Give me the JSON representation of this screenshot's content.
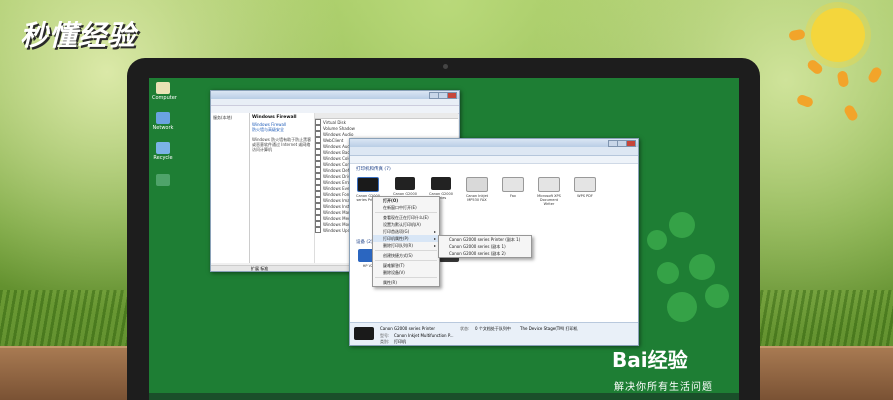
{
  "watermark": {
    "logo_text": "秒懂经验"
  },
  "branding": {
    "baidu_text": "Bai经验",
    "baidu_slogan": "解决你所有生活问题"
  },
  "desktop": {
    "icons": [
      {
        "label": "Computer"
      },
      {
        "label": "Network"
      },
      {
        "label": "Recycle"
      },
      {
        "label": ""
      }
    ]
  },
  "firewall_window": {
    "title": "Windows Firewall",
    "side_link_1": "Windows Firewall",
    "side_link_2": "防火墙与高级安全",
    "side_text": "Windows 防火墙有助于防止黑客或恶意软件通过 Internet 或网络访问计算机",
    "services": [
      "Virtual Disk",
      "Volume Shadow",
      "Windows Audio",
      "WebClient",
      "Windows Audi...",
      "Windows Back...",
      "Windows Color...",
      "Windows Conn...",
      "Windows Defe...",
      "Windows Driv...",
      "Windows Error...",
      "Windows Event...",
      "Windows Font...",
      "Windows Imag...",
      "Windows Inst...",
      "Windows Man...",
      "Windows Med...",
      "Windows Mod...",
      "Windows Upd..."
    ],
    "status": "扩展  标准"
  },
  "devices_window": {
    "section_label": "打印机和传真 (7)",
    "printers": [
      {
        "name": "Canon G2000 series Printer"
      },
      {
        "name": "Canon G2000 series"
      },
      {
        "name": "Canon G2000 series"
      },
      {
        "name": "Canon Inkjet MP530 FAX"
      },
      {
        "name": "Fax"
      },
      {
        "name": "Microsoft XPS Document Writer"
      },
      {
        "name": "WPS PDF"
      }
    ],
    "devices_label": "设备 (2)",
    "device_names": [
      "HP V2",
      ""
    ],
    "details": {
      "name": "Canon G2000 series Printer",
      "state_label": "状态:",
      "state_value": "0 个文档处于队列中",
      "model_label": "型号:",
      "model_value": "Canon Inkjet Multifunction P...",
      "category_label": "类别:",
      "category_value": "打印机",
      "status_line": "The Device Stage(TM) 打印机"
    }
  },
  "context_menu": {
    "items": [
      {
        "label": "打开(O)"
      },
      {
        "label": "在新窗口中打开(E)"
      },
      {
        "label": "查看现在正在打印什么(E)"
      },
      {
        "label": "设置为默认打印机(A)"
      },
      {
        "label": "打印首选项(G)"
      },
      {
        "label": "打印机属性(P)"
      },
      {
        "label": "删除打印队列(R)"
      },
      {
        "label": "创建快捷方式(S)"
      },
      {
        "label": "疑难解答(T)"
      },
      {
        "label": "删除设备(V)"
      },
      {
        "label": "属性(R)"
      }
    ]
  },
  "submenu": {
    "items": [
      {
        "label": "Canon G2000 series Printer (副本 1)"
      },
      {
        "label": "Canon G2000 series (副本 1)"
      },
      {
        "label": "Canon G2000 series (副本 2)"
      }
    ]
  },
  "colors": {
    "screen_bg": "#1e7e34",
    "accent_green": "#3aa84b"
  }
}
